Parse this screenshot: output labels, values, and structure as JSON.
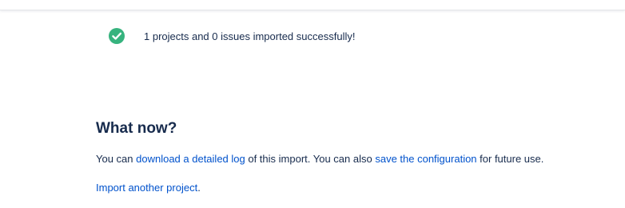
{
  "header": {
    "divider": true
  },
  "result": {
    "icon": "check-circle-icon",
    "icon_color": "#36b37e",
    "message": "1 projects and 0 issues imported successfully!"
  },
  "what_now": {
    "heading": "What now?",
    "line1_prefix": "You can ",
    "download_log_link": "download a detailed log",
    "line1_middle": " of this import. You can also ",
    "save_config_link": "save the configuration",
    "line1_suffix": " for future use.",
    "import_another_link": "Import another project",
    "import_another_suffix": "."
  },
  "colors": {
    "text": "#172b4d",
    "link": "#0052cc",
    "success": "#36b37e"
  }
}
